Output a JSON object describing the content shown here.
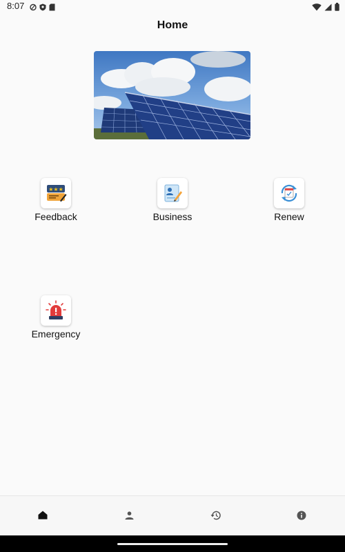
{
  "status_bar": {
    "time": "8:07"
  },
  "header": {
    "title": "Home"
  },
  "tiles": [
    {
      "label": "Feedback",
      "icon": "feedback-icon"
    },
    {
      "label": "Business",
      "icon": "business-icon"
    },
    {
      "label": "Renew",
      "icon": "renew-icon"
    },
    {
      "label": "Emergency",
      "icon": "emergency-icon"
    }
  ],
  "bottom_nav": [
    {
      "icon": "home-icon",
      "active": true
    },
    {
      "icon": "person-icon",
      "active": false
    },
    {
      "icon": "history-icon",
      "active": false
    },
    {
      "icon": "info-icon",
      "active": false
    }
  ],
  "colors": {
    "background": "#fafafa",
    "active_nav": "#111111",
    "inactive_nav": "#555555"
  }
}
